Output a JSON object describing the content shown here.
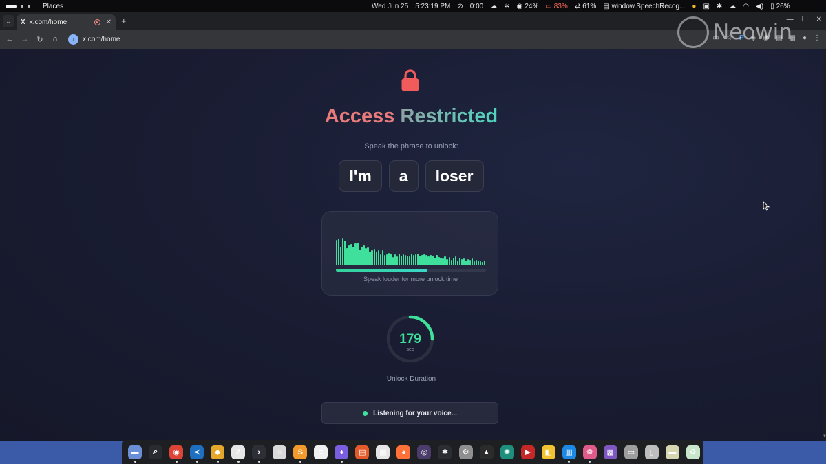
{
  "system_panel": {
    "workspace_label": "Places",
    "date": "Wed Jun 25",
    "time": "5:23:19 PM",
    "timer": "0:00",
    "cpu": "24%",
    "battery_warn": "83%",
    "sync": "61%",
    "window_title": "window.SpeechRecog...",
    "battery": "26%"
  },
  "browser": {
    "tab_title": "x.com/home",
    "tab_favicon": "X",
    "url": "x.com/home"
  },
  "watermark": "Neowin",
  "page": {
    "heading_word1": "Access",
    "heading_word2": "Restricted",
    "prompt": "Speak the phrase to unlock:",
    "phrase_words": [
      "I'm",
      "a",
      "loser"
    ],
    "visualizer_hint": "Speak louder for more unlock time",
    "meter_fraction": 0.61,
    "countdown_value": "179",
    "countdown_unit": "sec",
    "countdown_fraction": 0.25,
    "countdown_label": "Unlock Duration",
    "status_text": "Listening for your voice..."
  },
  "audio_levels": [
    0.74,
    0.78,
    0.55,
    0.8,
    0.72,
    0.5,
    0.58,
    0.62,
    0.54,
    0.64,
    0.66,
    0.46,
    0.55,
    0.59,
    0.5,
    0.52,
    0.4,
    0.45,
    0.48,
    0.4,
    0.44,
    0.32,
    0.45,
    0.3,
    0.32,
    0.37,
    0.34,
    0.24,
    0.32,
    0.26,
    0.34,
    0.28,
    0.32,
    0.3,
    0.28,
    0.26,
    0.34,
    0.3,
    0.32,
    0.34,
    0.28,
    0.3,
    0.32,
    0.3,
    0.26,
    0.3,
    0.28,
    0.22,
    0.3,
    0.24,
    0.22,
    0.2,
    0.26,
    0.18,
    0.24,
    0.16,
    0.22,
    0.26,
    0.14,
    0.22,
    0.18,
    0.2,
    0.14,
    0.18,
    0.16,
    0.2,
    0.12,
    0.16,
    0.14,
    0.12,
    0.1,
    0.14
  ],
  "colors": {
    "accent_green": "#3ee09c",
    "lock_red": "#f25b5b",
    "heading_red": "#e77a7a",
    "heading_teal": "#4ed6c0",
    "page_bg": "#1a1d33"
  },
  "dock": {
    "apps": [
      {
        "name": "files-icon",
        "glyph": "▬",
        "color": "#6b8fd6",
        "running": true
      },
      {
        "name": "search-icon",
        "glyph": "⌕",
        "color": "#2a2b30",
        "running": false
      },
      {
        "name": "chrome-icon",
        "glyph": "◉",
        "color": "#db4437",
        "running": true
      },
      {
        "name": "vscode-icon",
        "glyph": "≺",
        "color": "#1f6fc1",
        "running": true
      },
      {
        "name": "duck-icon",
        "glyph": "◆",
        "color": "#e4a72b",
        "running": true
      },
      {
        "name": "zed-icon",
        "glyph": "Z",
        "color": "#e6e6e6",
        "running": true
      },
      {
        "name": "terminal-icon",
        "glyph": "›",
        "color": "#2d2f36",
        "running": true
      },
      {
        "name": "magnifier-icon",
        "glyph": "○",
        "color": "#d9d9d9",
        "running": false
      },
      {
        "name": "sublime-icon",
        "glyph": "S",
        "color": "#f29a2c",
        "running": true
      },
      {
        "name": "notes-icon",
        "glyph": "≡",
        "color": "#f0f0f0",
        "running": false
      },
      {
        "name": "crystal-icon",
        "glyph": "♦",
        "color": "#7a5ee0",
        "running": true
      },
      {
        "name": "docs-icon",
        "glyph": "▤",
        "color": "#e45a2a",
        "running": false
      },
      {
        "name": "text-editor-icon",
        "glyph": "▦",
        "color": "#e6e6e6",
        "running": false
      },
      {
        "name": "firefox-icon",
        "glyph": "◕",
        "color": "#ff7139",
        "running": false
      },
      {
        "name": "obs-icon",
        "glyph": "◎",
        "color": "#4a3d6b",
        "running": false
      },
      {
        "name": "slack-icon",
        "glyph": "✱",
        "color": "#2c2d33",
        "running": false
      },
      {
        "name": "settings-icon",
        "glyph": "⚙",
        "color": "#8f8f8f",
        "running": false
      },
      {
        "name": "inkscape-icon",
        "glyph": "▲",
        "color": "#2b2b2b",
        "running": false
      },
      {
        "name": "mail-icon",
        "glyph": "✺",
        "color": "#1d8f7c",
        "running": false
      },
      {
        "name": "video-icon",
        "glyph": "▶",
        "color": "#c62828",
        "running": false
      },
      {
        "name": "tasks-icon",
        "glyph": "◧",
        "color": "#f2c230",
        "running": false
      },
      {
        "name": "trello-icon",
        "glyph": "▥",
        "color": "#1e88e5",
        "running": true
      },
      {
        "name": "photos-icon",
        "glyph": "❁",
        "color": "#e05a8a",
        "running": true
      },
      {
        "name": "palette-icon",
        "glyph": "▩",
        "color": "#7e57c2",
        "running": false
      },
      {
        "name": "archive-icon",
        "glyph": "▭",
        "color": "#9e9e9e",
        "running": false
      },
      {
        "name": "document-icon",
        "glyph": "▯",
        "color": "#bdbdbd",
        "running": false
      },
      {
        "name": "folder-icon",
        "glyph": "▬",
        "color": "#d6d6b0",
        "running": false
      },
      {
        "name": "trash-icon",
        "glyph": "♻",
        "color": "#c8e6c9",
        "running": false
      }
    ]
  }
}
